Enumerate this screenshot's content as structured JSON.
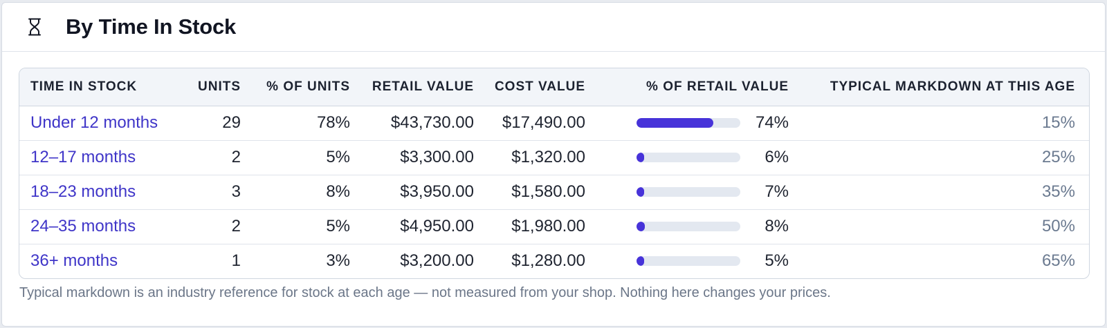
{
  "card": {
    "title": "By Time In Stock",
    "icon": "hourglass-icon"
  },
  "table": {
    "columns": [
      "Time In Stock",
      "Units",
      "% of Units",
      "Retail Value",
      "Cost Value",
      "% of Retail Value",
      "Typical Markdown At This Age"
    ],
    "rows": [
      {
        "label": "Under 12 months",
        "units": "29",
        "pct_units": "78%",
        "retail": "$43,730.00",
        "cost": "$17,490.00",
        "pct_retail": "74%",
        "pct_retail_value": 74,
        "markdown": "15%"
      },
      {
        "label": "12–17 months",
        "units": "2",
        "pct_units": "5%",
        "retail": "$3,300.00",
        "cost": "$1,320.00",
        "pct_retail": "6%",
        "pct_retail_value": 6,
        "markdown": "25%"
      },
      {
        "label": "18–23 months",
        "units": "3",
        "pct_units": "8%",
        "retail": "$3,950.00",
        "cost": "$1,580.00",
        "pct_retail": "7%",
        "pct_retail_value": 7,
        "markdown": "35%"
      },
      {
        "label": "24–35 months",
        "units": "2",
        "pct_units": "5%",
        "retail": "$4,950.00",
        "cost": "$1,980.00",
        "pct_retail": "8%",
        "pct_retail_value": 8,
        "markdown": "50%"
      },
      {
        "label": "36+ months",
        "units": "1",
        "pct_units": "3%",
        "retail": "$3,200.00",
        "cost": "$1,280.00",
        "pct_retail": "5%",
        "pct_retail_value": 5,
        "markdown": "65%"
      }
    ]
  },
  "footnote": "Typical markdown is an industry reference for stock at each age — not measured from your shop. Nothing here changes your prices.",
  "colors": {
    "accent": "#4733d9",
    "link": "#3f35c8",
    "muted": "#6b7a90",
    "track": "#e3e8f0"
  }
}
